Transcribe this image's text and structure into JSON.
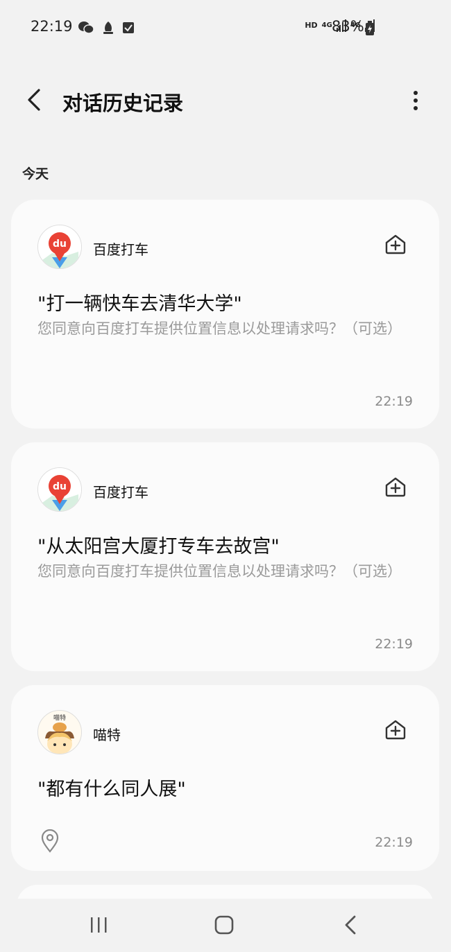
{
  "status_bar": {
    "time": "22:19",
    "left_icons": [
      "wechat-icon",
      "app-icon",
      "checkbox-icon"
    ],
    "network": [
      "HD",
      "4G",
      "4G"
    ],
    "battery": "83%"
  },
  "header": {
    "title": "对话历史记录"
  },
  "section": {
    "label": "今天"
  },
  "cards": [
    {
      "app": "百度打车",
      "query": "\"打一辆快车去清华大学\"",
      "subtitle": "您同意向百度打车提供位置信息以处理请求吗？（可选）",
      "time": "22:19",
      "avatar_badge": "du"
    },
    {
      "app": "百度打车",
      "query": "\"从太阳宫大厦打专车去故宫\"",
      "subtitle": "您同意向百度打车提供位置信息以处理请求吗？（可选）",
      "time": "22:19",
      "avatar_badge": "du"
    },
    {
      "app": "喵特",
      "query": "\"都有什么同人展\"",
      "time": "22:19",
      "avatar_badge": "喵特"
    }
  ],
  "colors": {
    "background": "#f2f2f2",
    "card": "#fbfbfb",
    "baidu_red": "#e94235",
    "subtitle_gray": "#9a9a9a"
  }
}
